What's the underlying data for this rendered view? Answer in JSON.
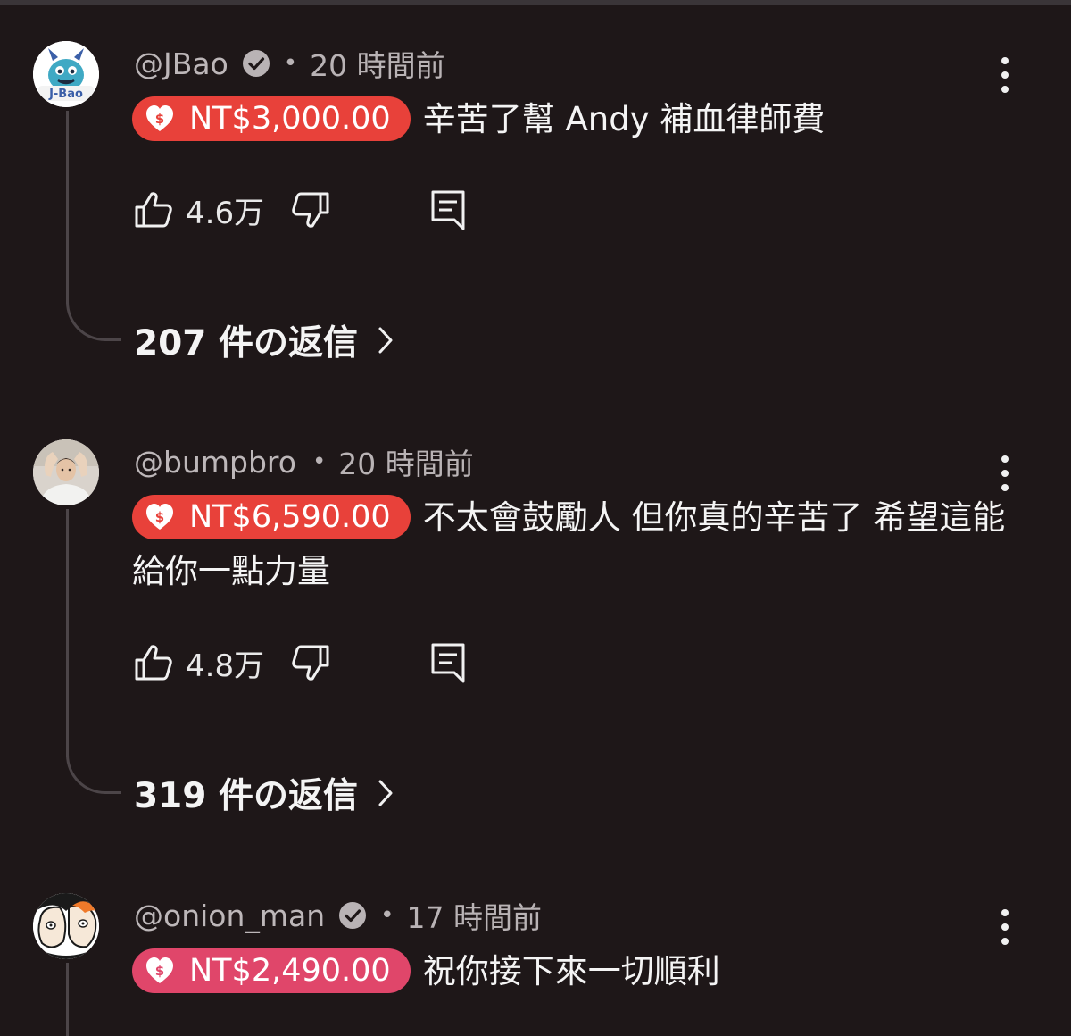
{
  "comments": [
    {
      "handle": "@JBao",
      "verified": true,
      "time": "20 時間前",
      "amount": "NT$3,000.00",
      "amount_color": "#e8413a",
      "text": "辛苦了幫 Andy 補血律師費",
      "likes": "4.6万",
      "replies": "207 件の返信",
      "avatar_label": "J-Bao"
    },
    {
      "handle": "@bumpbro",
      "verified": false,
      "time": "20 時間前",
      "amount": "NT$6,590.00",
      "amount_color": "#e8413a",
      "text": "不太會鼓勵人 但你真的辛苦了 希望這能給你一點力量",
      "likes": "4.8万",
      "replies": "319 件の返信"
    },
    {
      "handle": "@onion_man",
      "verified": true,
      "time": "17 時間前",
      "amount": "NT$2,490.00",
      "amount_color": "#e0466a",
      "text": "祝你接下來一切順利"
    }
  ],
  "separator": "•",
  "colors": {
    "background": "#1e1718",
    "thread_line": "#4c4548",
    "muted_text": "#b9b3b5"
  },
  "icons": [
    "verified-badge-icon",
    "dollar-heart-icon",
    "thumb-up-icon",
    "thumb-down-icon",
    "reply-icon",
    "chevron-right-icon",
    "more-vert-icon"
  ]
}
